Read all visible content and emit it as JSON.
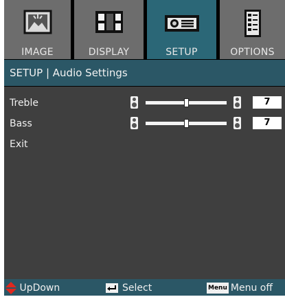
{
  "tabs": [
    {
      "label": "IMAGE",
      "icon": "image-icon",
      "active": false
    },
    {
      "label": "DISPLAY",
      "icon": "display-icon",
      "active": false
    },
    {
      "label": "SETUP",
      "icon": "projector-icon",
      "active": true
    },
    {
      "label": "OPTIONS",
      "icon": "options-icon",
      "active": false
    }
  ],
  "breadcrumb": "SETUP | Audio Settings",
  "settings": [
    {
      "label": "Treble",
      "value": "7",
      "level_percent": 50
    },
    {
      "label": "Bass",
      "value": "7",
      "level_percent": 50
    },
    {
      "label": "Exit"
    }
  ],
  "footer": {
    "updown": "UpDown",
    "select": "Select",
    "menu_key": "Menu",
    "menu_off": "Menu off"
  },
  "colors": {
    "active_tab": "#2b6777",
    "inactive_tab": "#6d6d6d",
    "header_bar": "#2b5766",
    "panel": "#3f3f3f",
    "updown_arrow": "#e0281e"
  }
}
